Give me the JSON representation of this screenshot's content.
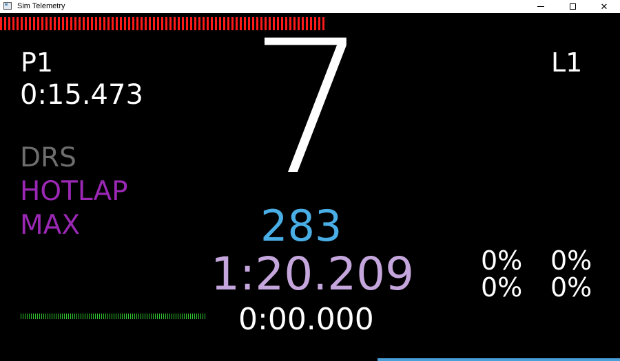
{
  "window": {
    "title": "Sim Telemetry",
    "icon": "app-window-icon",
    "controls": {
      "minimize": "minimize-icon",
      "maximize": "maximize-icon",
      "close": "close-icon",
      "close_glyph": "✕"
    }
  },
  "telemetry": {
    "position": "P1",
    "lap": "L1",
    "current_lap_time": "0:15.473",
    "gear": "7",
    "speed": "283",
    "best_lap_time": "1:20.209",
    "delta_time": "0:00.000",
    "flags": {
      "drs": "DRS",
      "hotlap": "HOTLAP",
      "max": "MAX"
    },
    "tyres": {
      "front_left": "0%",
      "front_right": "0%",
      "rear_left": "0%",
      "rear_right": "0%"
    }
  },
  "colors": {
    "background": "#000000",
    "rpm_leds": "#ff1a1a",
    "fuel_bar": "#2ec82e",
    "speed": "#4aaee6",
    "best_lap": "#c4a6dc",
    "flag_inactive": "#6e6e6e",
    "flag_active": "#9a28b4"
  }
}
